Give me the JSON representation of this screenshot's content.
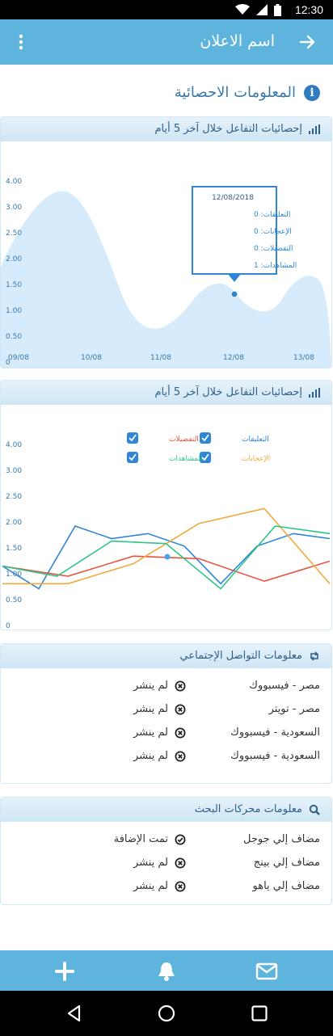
{
  "status_bar": {
    "time": "12:30"
  },
  "app_bar": {
    "title": "اسم الاعلان"
  },
  "stats_section": {
    "title": "المعلومات الاحصائية"
  },
  "chart1_card": {
    "title": "إحصائيات التفاعل خلال آخر 5 أيام"
  },
  "chart2_card": {
    "title": "إحصائيات التفاعل خلال آخر 5 أيام"
  },
  "chart_data": [
    {
      "type": "area",
      "x": [
        "09/08",
        "10/08",
        "11/08",
        "12/08",
        "13/08"
      ],
      "y_ticks": [
        "4.00",
        "3.00",
        "2.50",
        "2.00",
        "1.50",
        "1.00",
        "0.50",
        "0"
      ],
      "series": [
        {
          "values": [
            2.85,
            2.2,
            0.6,
            1.55,
            1.7
          ]
        }
      ],
      "tooltip": {
        "date": "12/08/2018",
        "lines": [
          "التعليقات: 0",
          "الإعجابات: 0",
          "التفضيلات: 0",
          "المشاهدات: 1"
        ]
      },
      "colors": {
        "fill": "#d6ebfb",
        "point": "#2f86d6"
      }
    },
    {
      "type": "line",
      "x": [
        "09/08",
        "10/08",
        "11/08",
        "12/08",
        "13/08"
      ],
      "y_ticks": [
        "4.00",
        "3.00",
        "2.50",
        "2.00",
        "1.50",
        "1.00",
        "0.50",
        "0"
      ],
      "legend": [
        {
          "name": "التعليقات",
          "color": "#2f86d6"
        },
        {
          "name": "التفضيلات",
          "color": "#e8543f"
        },
        {
          "name": "الإعجابات",
          "color": "#f2a93b"
        },
        {
          "name": "المشاهدات",
          "color": "#2fc48a"
        }
      ],
      "series": [
        {
          "name": "التعليقات",
          "color": "#2f86d6",
          "values": [
            1.2,
            0.75,
            2.0,
            1.75,
            1.85,
            1.6,
            0.85,
            1.6,
            1.85,
            1.75
          ]
        },
        {
          "name": "التفضيلات",
          "color": "#e8543f",
          "values": [
            1.2,
            1.0,
            1.4,
            1.35,
            0.9,
            1.3
          ]
        },
        {
          "name": "الإعجابات",
          "color": "#f2a93b",
          "values": [
            0.85,
            0.85,
            1.25,
            2.05,
            2.35,
            0.85
          ]
        },
        {
          "name": "المشاهدات",
          "color": "#2fc48a",
          "values": [
            1.2,
            1.0,
            1.7,
            1.65,
            0.75,
            2.0,
            1.85
          ]
        }
      ]
    }
  ],
  "social_card": {
    "title": "معلومات التواصل الإجتماعي",
    "rows": [
      {
        "label": "مصر - فيسبووك",
        "status": "لم ينشر"
      },
      {
        "label": "مصر - تويتر",
        "status": "لم ينشر"
      },
      {
        "label": "السعودية - فيسبووك",
        "status": "لم ينشر"
      },
      {
        "label": "السعودية - فيسبووك",
        "status": "لم ينشر"
      }
    ]
  },
  "search_card": {
    "title": "معلومات محركات البحث",
    "rows": [
      {
        "label": "مضاف إلي جوجل",
        "status": "تمت الإضافة",
        "icon": "check-circle-icon"
      },
      {
        "label": "مضاف إلي بينج",
        "status": "لم ينشر",
        "icon": "x-circle-icon"
      },
      {
        "label": "مضاف إلي ياهو",
        "status": "لم ينشر",
        "icon": "x-circle-icon"
      }
    ]
  }
}
